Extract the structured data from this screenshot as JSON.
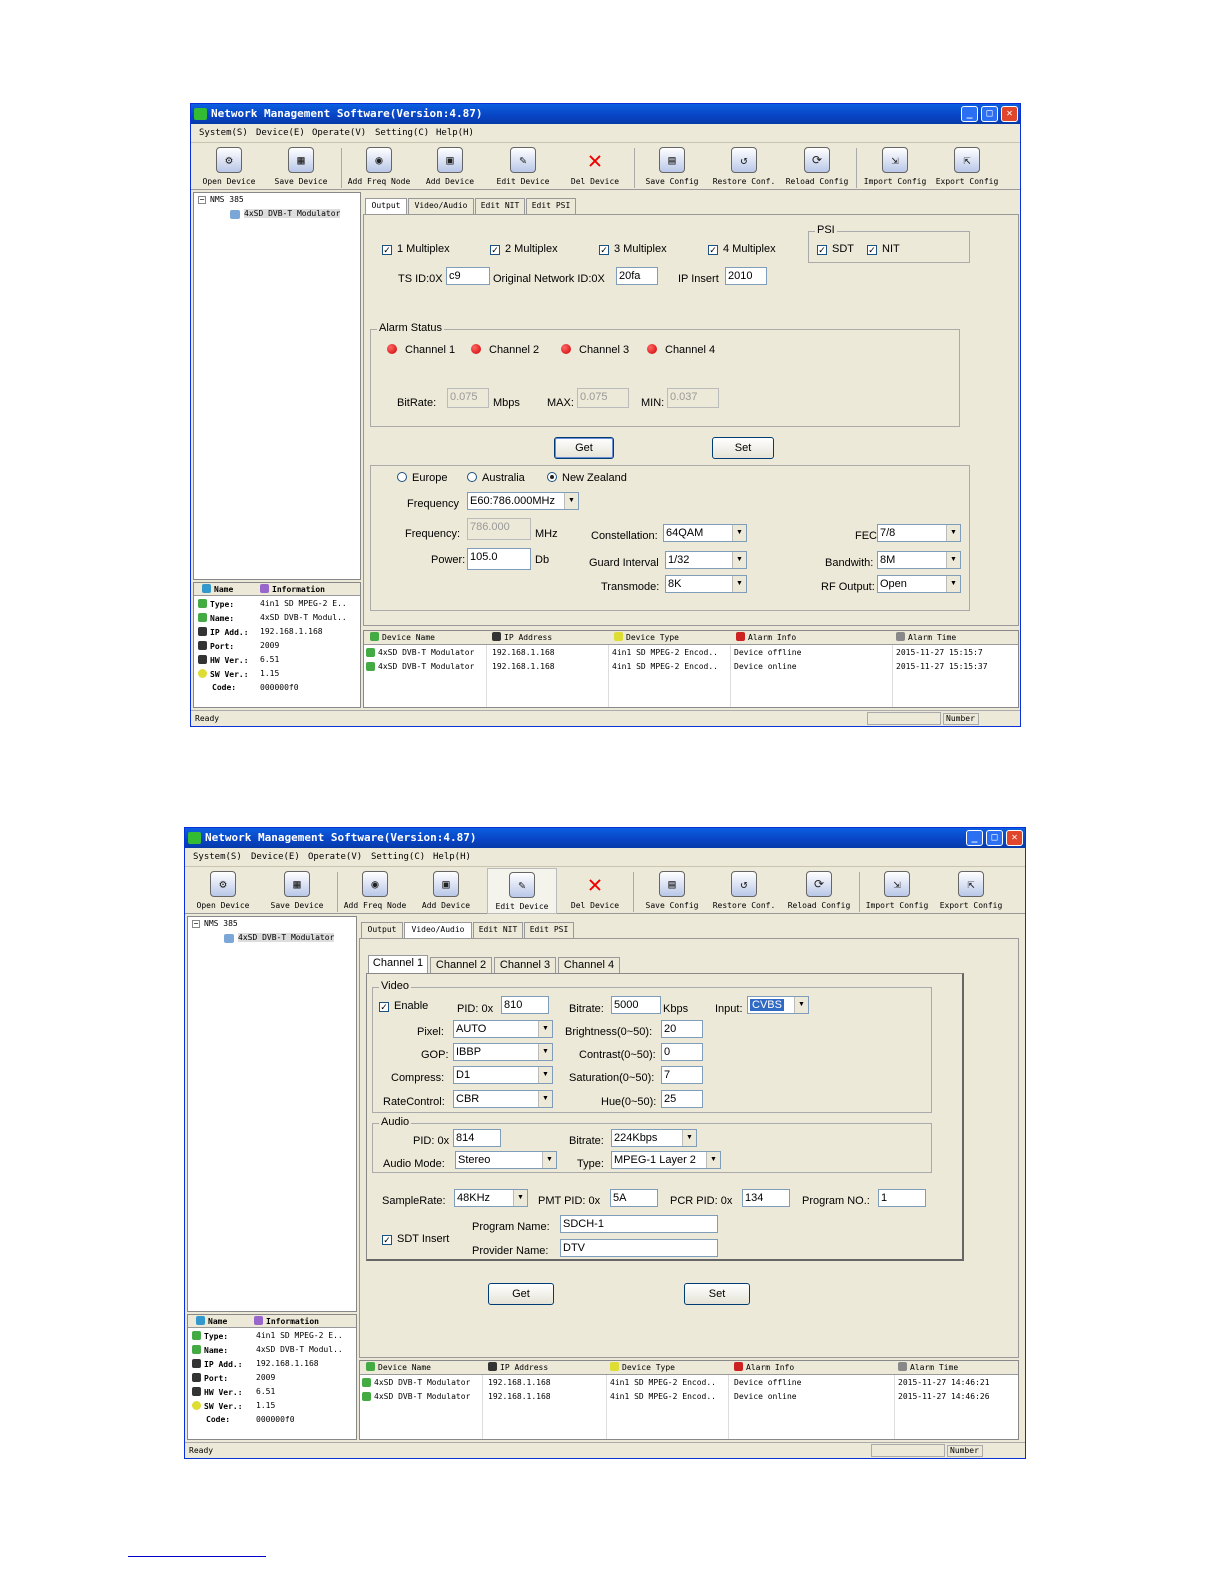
{
  "app": {
    "title": "Network Management Software(Version:4.87)",
    "menu": [
      "System(S)",
      "Device(E)",
      "Operate(V)",
      "Setting(C)",
      "Help(H)"
    ],
    "toolbar": [
      "Open Device",
      "Save Device",
      "Add Freq Node",
      "Add Device",
      "Edit Device",
      "Del Device",
      "Save Config",
      "Restore Conf.",
      "Reload Config",
      "Import Config",
      "Export Config"
    ],
    "tabs": [
      "Output",
      "Video/Audio",
      "Edit NIT",
      "Edit PSI"
    ],
    "info_header": [
      "Name",
      "Information"
    ],
    "grid_header": [
      "Device Name",
      "IP Address",
      "Device Type",
      "Alarm Info",
      "Alarm Time"
    ],
    "status_ready": "Ready",
    "status_number": "Number"
  },
  "win1": {
    "tree_root": "NMS 385",
    "tree_child": "4xSD DVB-T Modulator",
    "info": [
      {
        "k": "Type:",
        "v": "4in1 SD MPEG-2 E.."
      },
      {
        "k": "Name:",
        "v": "4xSD DVB-T Modul.."
      },
      {
        "k": "IP Add.:",
        "v": "192.168.1.168"
      },
      {
        "k": "Port:",
        "v": "2009"
      },
      {
        "k": "HW Ver.:",
        "v": "6.51"
      },
      {
        "k": "SW Ver.:",
        "v": "1.15"
      },
      {
        "k": "Code:",
        "v": "000000f0"
      }
    ],
    "output": {
      "multiplex": [
        "1 Multiplex",
        "2 Multiplex",
        "3 Multiplex",
        "4 Multiplex"
      ],
      "psi_label": "PSI",
      "psi": [
        "SDT",
        "NIT"
      ],
      "ts_id_label": "TS ID:0X",
      "ts_id": "c9",
      "onid_label": "Original Network ID:0X",
      "onid": "20fa",
      "ip_insert_label": "IP Insert",
      "ip_insert": "2010",
      "alarm_label": "Alarm Status",
      "channels": [
        "Channel 1",
        "Channel 2",
        "Channel 3",
        "Channel 4"
      ],
      "bitrate_label": "BitRate:",
      "bitrate": "0.075",
      "mbps": "Mbps",
      "max_label": "MAX:",
      "max": "0.075",
      "min_label": "MIN:",
      "min": "0.037",
      "get": "Get",
      "set": "Set",
      "regions": [
        "Europe",
        "Australia",
        "New Zealand"
      ],
      "freq_label": "Frequency",
      "freq_sel": "E60:786.000MHz",
      "freq2_label": "Frequency:",
      "freq2": "786.000",
      "mhz": "MHz",
      "power_label": "Power:",
      "power": "105.0",
      "db": "Db",
      "const_label": "Constellation:",
      "const": "64QAM",
      "gi_label": "Guard Interval",
      "gi": "1/32",
      "tm_label": "Transmode:",
      "tm": "8K",
      "fec_label": "FEC",
      "fec": "7/8",
      "bw_label": "Bandwith:",
      "bw": "8M",
      "rf_label": "RF Output:",
      "rf": "Open"
    },
    "rows": [
      [
        "4xSD DVB-T Modulator",
        "192.168.1.168",
        "4in1 SD MPEG-2 Encod..",
        "Device offline",
        "2015-11-27 15:15:7"
      ],
      [
        "4xSD DVB-T Modulator",
        "192.168.1.168",
        "4in1 SD MPEG-2 Encod..",
        "Device online",
        "2015-11-27 15:15:37"
      ]
    ]
  },
  "win2": {
    "tree_root": "NMS 385",
    "tree_child": "4xSD DVB-T Modulator",
    "info": [
      {
        "k": "Type:",
        "v": "4in1 SD MPEG-2 E.."
      },
      {
        "k": "Name:",
        "v": "4xSD DVB-T Modul.."
      },
      {
        "k": "IP Add.:",
        "v": "192.168.1.168"
      },
      {
        "k": "Port:",
        "v": "2009"
      },
      {
        "k": "HW Ver.:",
        "v": "6.51"
      },
      {
        "k": "SW Ver.:",
        "v": "1.15"
      },
      {
        "k": "Code:",
        "v": "000000f0"
      }
    ],
    "va": {
      "channel_tabs": [
        "Channel 1",
        "Channel 2",
        "Channel 3",
        "Channel 4"
      ],
      "video_label": "Video",
      "enable_label": "Enable",
      "pid_label": "PID: 0x",
      "pid": "810",
      "bitrate_label": "Bitrate:",
      "bitrate": "5000",
      "kbps": "Kbps",
      "input_label": "Input:",
      "input": "CVBS",
      "pixel_label": "Pixel:",
      "pixel": "AUTO",
      "gop_label": "GOP:",
      "gop": "IBBP",
      "compress_label": "Compress:",
      "compress": "D1",
      "rc_label": "RateControl:",
      "rc": "CBR",
      "brightness_label": "Brightness(0~50):",
      "brightness": "20",
      "contrast_label": "Contrast(0~50):",
      "contrast": "0",
      "saturation_label": "Saturation(0~50):",
      "saturation": "7",
      "hue_label": "Hue(0~50):",
      "hue": "25",
      "audio_label": "Audio",
      "apid_label": "PID: 0x",
      "apid": "814",
      "abitrate_label": "Bitrate:",
      "abitrate": "224Kbps",
      "amode_label": "Audio Mode:",
      "amode": "Stereo",
      "atype_label": "Type:",
      "atype": "MPEG-1 Layer 2",
      "sr_label": "SampleRate:",
      "sr": "48KHz",
      "pmt_label": "PMT PID: 0x",
      "pmt": "5A",
      "pcr_label": "PCR PID: 0x",
      "pcr": "134",
      "prog_label": "Program NO.:",
      "prog": "1",
      "sdt_label": "SDT Insert",
      "pname_label": "Program Name:",
      "pname": "SDCH-1",
      "prov_label": "Provider Name:",
      "prov": "DTV",
      "get": "Get",
      "set": "Set"
    },
    "rows": [
      [
        "4xSD DVB-T Modulator",
        "192.168.1.168",
        "4in1 SD MPEG-2 Encod..",
        "Device offline",
        "2015-11-27 14:46:21"
      ],
      [
        "4xSD DVB-T Modulator",
        "192.168.1.168",
        "4in1 SD MPEG-2 Encod..",
        "Device online",
        "2015-11-27 14:46:26"
      ]
    ]
  }
}
